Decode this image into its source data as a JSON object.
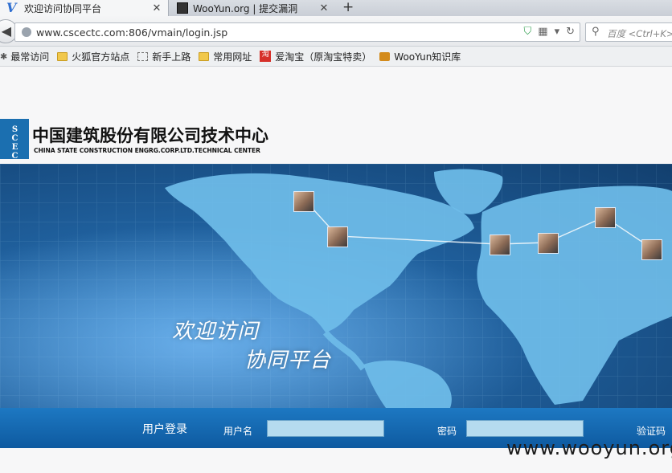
{
  "browser": {
    "tabs": [
      {
        "label": "欢迎访问协同平台",
        "active": true
      },
      {
        "label": "WooYun.org | 提交漏洞",
        "active": false
      }
    ],
    "new_tab_glyph": "+",
    "close_glyph": "✕",
    "url": "www.cscectc.com:806/vmain/login.jsp",
    "search_placeholder": "百度 <Ctrl+K>",
    "bookmarks": [
      {
        "label": "最常访问",
        "icon": "gear-icon"
      },
      {
        "label": "火狐官方站点",
        "icon": "folder-icon"
      },
      {
        "label": "新手上路",
        "icon": "dashed-page-icon"
      },
      {
        "label": "常用网址",
        "icon": "folder-icon"
      },
      {
        "label": "爱淘宝（原淘宝特卖）",
        "icon": "taobao-icon"
      },
      {
        "label": "WooYun知识库",
        "icon": "rss-icon"
      }
    ]
  },
  "header": {
    "logo_text": "SCEC",
    "company_cn": "中国建筑股份有限公司技术中心",
    "company_en": "CHINA STATE CONSTRUCTION ENGRG.CORP.LTD.TECHNICAL CENTER"
  },
  "banner": {
    "welcome_line1": "欢迎访问",
    "welcome_line2": "协同平台"
  },
  "login": {
    "title": "用户登录",
    "username_label": "用户名",
    "password_label": "密码",
    "captcha_label": "验证码",
    "username_value": "",
    "password_value": ""
  },
  "watermark": "www.wooyun.org",
  "colors": {
    "banner_dark": "#123f6e",
    "banner_light": "#3f8fd0",
    "continent": "#7cc4ec",
    "login_bar": "#1d78c2",
    "field_bg": "#b5dbef"
  }
}
